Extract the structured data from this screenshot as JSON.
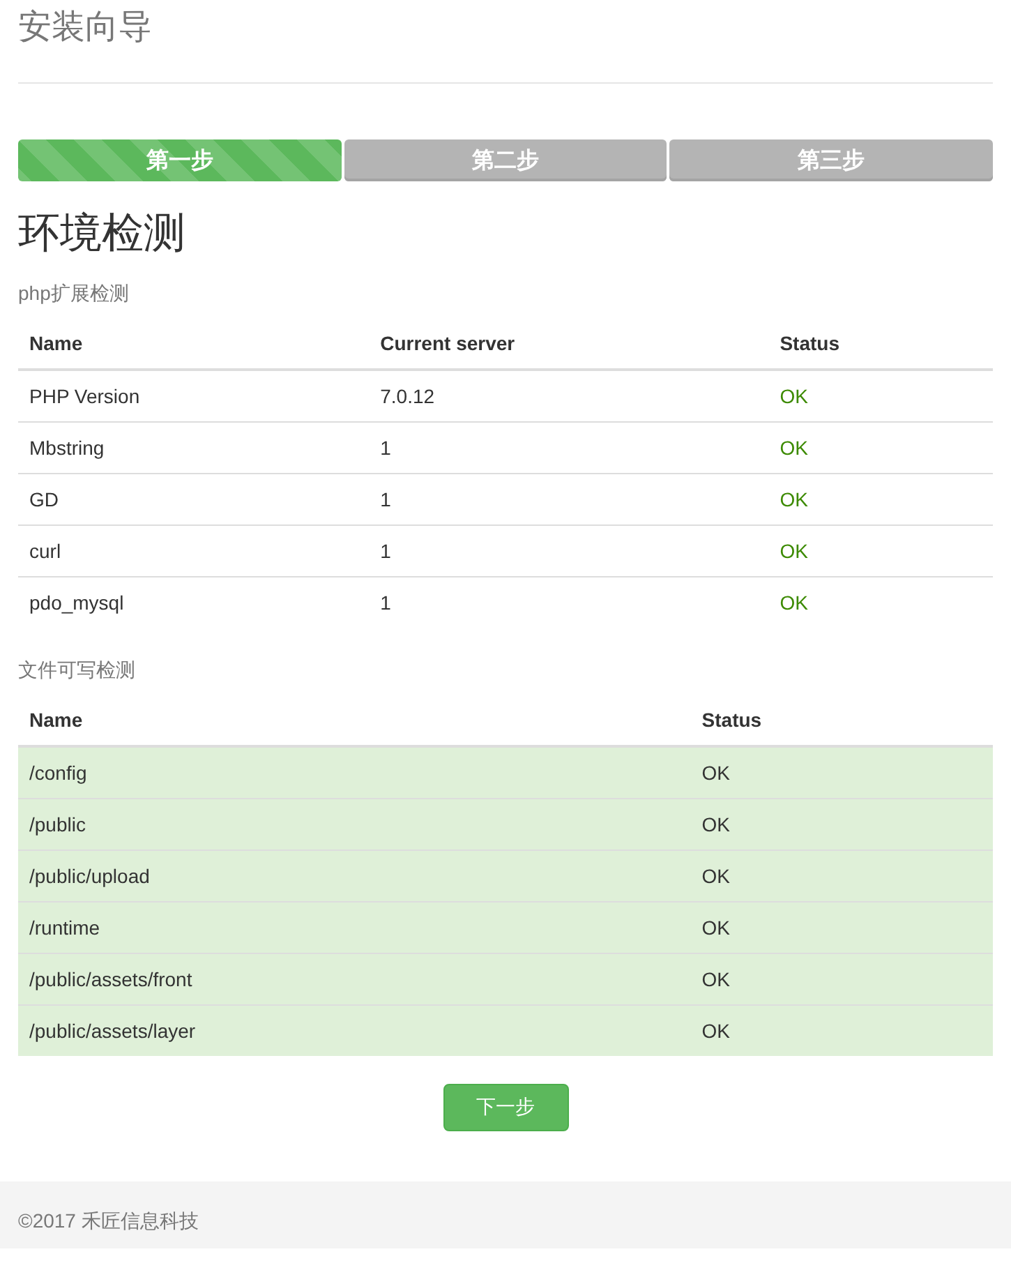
{
  "title": "安装向导",
  "steps": [
    {
      "label": "第一步",
      "selected": true
    },
    {
      "label": "第二步",
      "selected": false
    },
    {
      "label": "第三步",
      "selected": false
    }
  ],
  "heading": "环境检测",
  "sections": [
    {
      "label": "php扩展检测",
      "kind": "text",
      "columns": [
        "Name",
        "Current server",
        "Status"
      ],
      "rows": [
        {
          "cells": [
            "PHP Version",
            "7.0.12",
            "OK"
          ],
          "passed": true
        },
        {
          "cells": [
            "Mbstring",
            "1",
            "OK"
          ],
          "passed": true
        },
        {
          "cells": [
            "GD",
            "1",
            "OK"
          ],
          "passed": true
        },
        {
          "cells": [
            "curl",
            "1",
            "OK"
          ],
          "passed": true
        },
        {
          "cells": [
            "pdo_mysql",
            "1",
            "OK"
          ],
          "passed": true
        }
      ]
    },
    {
      "label": "文件可写检测",
      "kind": "row",
      "columns": [
        "Name",
        "Status"
      ],
      "rows": [
        {
          "cells": [
            "/config",
            "OK"
          ],
          "passed": true
        },
        {
          "cells": [
            "/public",
            "OK"
          ],
          "passed": true
        },
        {
          "cells": [
            "/public/upload",
            "OK"
          ],
          "passed": true
        },
        {
          "cells": [
            "/runtime",
            "OK"
          ],
          "passed": true
        },
        {
          "cells": [
            "/public/assets/front",
            "OK"
          ],
          "passed": true
        },
        {
          "cells": [
            "/public/assets/layer",
            "OK"
          ],
          "passed": true
        }
      ]
    }
  ],
  "next_button": "下一步",
  "footer": "©2017 禾匠信息科技"
}
